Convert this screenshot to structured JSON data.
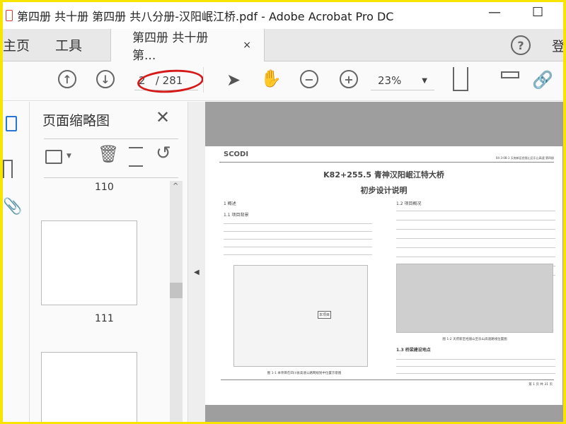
{
  "window": {
    "title": "第四册 共十册 第四册  共八分册-汉阳岷江桥.pdf - Adobe Acrobat Pro DC",
    "minimize": "—",
    "maximize": "☐"
  },
  "tabs": {
    "home": "主页",
    "tools": "工具",
    "document": "第四册 共十册 第...",
    "close": "×",
    "signin": "登"
  },
  "toolbar": {
    "page_current": "2",
    "page_total": "/ 281",
    "zoom": "23%"
  },
  "panel": {
    "title": "页面缩略图",
    "close": "✕",
    "thumbs": [
      "110",
      "111"
    ]
  },
  "document": {
    "header_right": "04-3-08-1 天府新区经眉山至乐山高速 第四册",
    "title": "K82+255.5 青神汉阳岷江特大桥",
    "subtitle": "初步设计说明",
    "s1": "1 概述",
    "s11": "1.1 项目背景",
    "s12": "1.2 项目概况",
    "s13": "1.3 桥梁建设地点",
    "fig1": "图 1-1 本项目在四川省高速公路网规划中位置示意图",
    "fig2": "图 1-2 天府新区经眉山至乐山高速路线位置图",
    "map_label": "本项目",
    "footer": "第 1 页 共 31 页",
    "logo": "SCODI"
  }
}
